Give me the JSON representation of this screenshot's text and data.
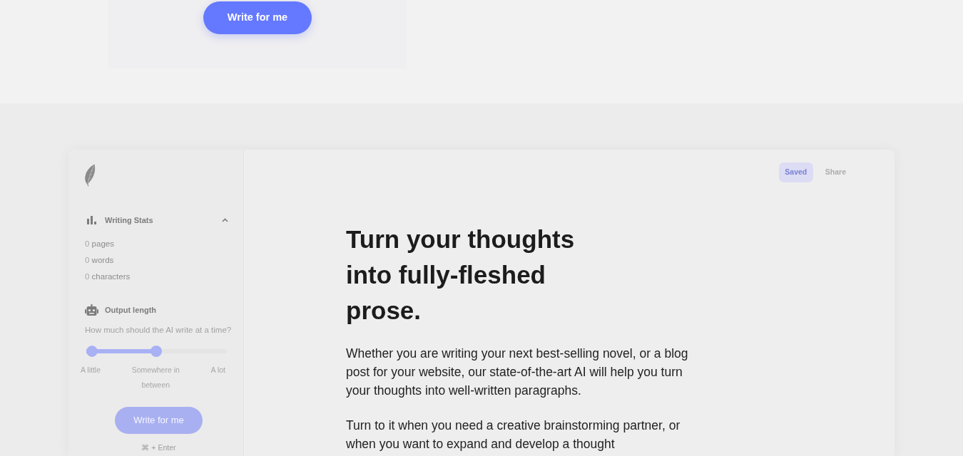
{
  "intro_panel": {
    "button": "Write for me"
  },
  "editor": {
    "sidebar": {
      "writing_stats": {
        "title": "Writing Stats",
        "expanded": true,
        "items": [
          {
            "count": "0",
            "label": "pages"
          },
          {
            "count": "0",
            "label": "words"
          },
          {
            "count": "0",
            "label": "characters"
          }
        ]
      },
      "output_length": {
        "title": "Output length",
        "question": "How much should the AI write at a time?",
        "slider": {
          "level": 0.5,
          "labels": [
            "A little",
            "Somewhere in between",
            "A lot"
          ]
        }
      },
      "button": "Write for me",
      "shortcut": "⌘ + Enter"
    },
    "toolbar": {
      "saved": "Saved",
      "share": "Share"
    },
    "document": {
      "heading": "Turn your thoughts into fully-fleshed prose.",
      "paragraphs": [
        "Whether you are writing your next best-selling novel, or a blog post for your website, our state-of-the-art AI will help you turn your thoughts into well-written paragraphs.",
        "Turn to it when you need a creative brainstorming partner, or when you want to expand and develop a thought"
      ]
    }
  }
}
